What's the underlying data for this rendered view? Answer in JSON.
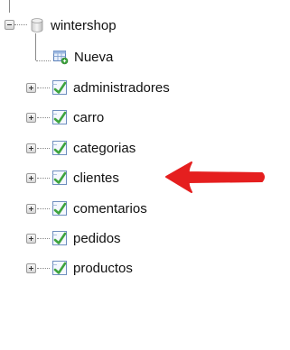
{
  "db": {
    "name": "wintershop",
    "icon": "database-icon"
  },
  "new_item": {
    "label": "Nueva",
    "icon": "new-table-icon"
  },
  "tables": [
    {
      "label": "administradores",
      "icon": "table-icon"
    },
    {
      "label": "carro",
      "icon": "table-icon"
    },
    {
      "label": "categorias",
      "icon": "table-icon"
    },
    {
      "label": "clientes",
      "icon": "table-icon"
    },
    {
      "label": "comentarios",
      "icon": "table-icon"
    },
    {
      "label": "pedidos",
      "icon": "table-icon"
    },
    {
      "label": "productos",
      "icon": "table-icon"
    }
  ],
  "annotation": {
    "icon": "red-arrow-icon",
    "color": "#e51f1f",
    "target": "clientes"
  },
  "colors": {
    "text": "#111111",
    "tree_line": "#8a8a8a",
    "table_icon_green": "#3ea43e"
  }
}
